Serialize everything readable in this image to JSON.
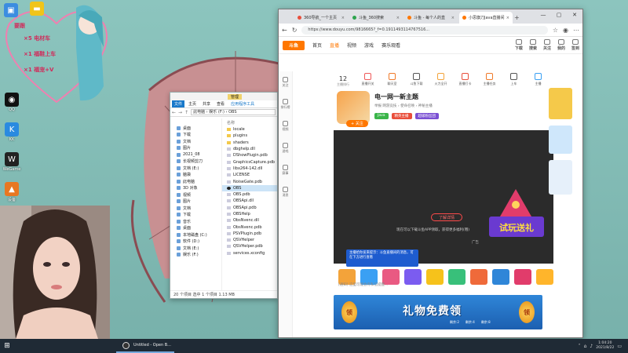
{
  "desktop": {
    "icons": [
      {
        "label": "QQ"
      },
      {
        "label": "KK"
      },
      {
        "label": "WeGame"
      },
      {
        "label": "设备"
      }
    ],
    "deco_lines": [
      "×5 电材车",
      "×1 福鞋上车",
      "×1 福宠+V"
    ],
    "deco_top": "要跟"
  },
  "explorer": {
    "title": "",
    "manage_label": "管理",
    "ribbon": [
      "文件",
      "主页",
      "共享",
      "查看",
      "应用程序工具"
    ],
    "path": "此电脑 › 娱乐 (F:) › OBS",
    "nav_items": [
      "桌面",
      "下载",
      "文档",
      "图片",
      "2021_08",
      "长视频剪刀",
      "文档 (E:)",
      "脑袋",
      "此电脑",
      "3D 对象",
      "视频",
      "图片",
      "文档",
      "下载",
      "音乐",
      "桌面",
      "本地磁盘 (C:)",
      "软件 (D:)",
      "文档 (E:)",
      "娱乐 (F:)"
    ],
    "column_header": "名称",
    "files": [
      {
        "name": "locale",
        "type": "folder"
      },
      {
        "name": "plugins",
        "type": "folder"
      },
      {
        "name": "shaders",
        "type": "folder"
      },
      {
        "name": "dbghelp.dll",
        "type": "file"
      },
      {
        "name": "DShowPlugin.pdb",
        "type": "file"
      },
      {
        "name": "GraphicsCapture.pdb",
        "type": "file"
      },
      {
        "name": "libx264-142.dll",
        "type": "file"
      },
      {
        "name": "LICENSE",
        "type": "file"
      },
      {
        "name": "NoiseGate.pdb",
        "type": "file"
      },
      {
        "name": "OBS",
        "type": "app"
      },
      {
        "name": "OBS.pdb",
        "type": "file"
      },
      {
        "name": "OBSApi.dll",
        "type": "file"
      },
      {
        "name": "OBSApi.pdb",
        "type": "file"
      },
      {
        "name": "OBSHelp",
        "type": "file"
      },
      {
        "name": "ObsNvenc.dll",
        "type": "file"
      },
      {
        "name": "ObsNvenc.pdb",
        "type": "file"
      },
      {
        "name": "PSVPlugin.pdb",
        "type": "file"
      },
      {
        "name": "QSVHelper",
        "type": "file"
      },
      {
        "name": "QSVHelper.pdb",
        "type": "file"
      },
      {
        "name": "services.xconfig",
        "type": "file"
      }
    ],
    "status": "20 个项目    选中 1 个项目  1.13 MB"
  },
  "browser": {
    "tabs": [
      {
        "label": "360导航_一个主页",
        "color": "#e94e3b"
      },
      {
        "label": "斗鱼_360搜索",
        "color": "#2da44e"
      },
      {
        "label": "斗鱼 - 每个人的直",
        "color": "#f70"
      },
      {
        "label": "小思旗刀Java直播间",
        "color": "#f70",
        "active": true
      }
    ],
    "url": "https://www.douyu.com/9816665?_f=0.1911493114767516...",
    "logo": "斗鱼",
    "nav": [
      "首页",
      "直播",
      "视频",
      "游戏",
      "赛乐观看"
    ],
    "nav_active": 1,
    "header_right": [
      "下载",
      "搜索",
      "关注",
      "我的",
      "签到"
    ],
    "sidebar": [
      "关注",
      "排行榜",
      "视频",
      "游戏",
      "赛事",
      "消息"
    ],
    "rank": {
      "num": "12",
      "label": "主播排行"
    },
    "toolbar": [
      "直播开关",
      "聊天室",
      "斗鱼下载",
      "火力全开",
      "直播打卡",
      "主播任务",
      "上车",
      "主播"
    ],
    "streamer": {
      "name": "电一网一新主题",
      "meta": "举报  网游竞技 › 使命召唤 › 神秘主播",
      "tags": [
        "Java",
        "精英主播",
        "超级粉丝团"
      ],
      "follow": "+ 关注"
    },
    "player": {
      "cta": "了解详情",
      "tip": "现在可以下载斗鱼APP领取，获得更多福利(哦)",
      "ad_tag": "广告"
    },
    "gift_tip": "主播给你发来提示：斗鱼直播间的消息，可在下方进行查看",
    "chat_placeholder": "[通知] 这里可能会有私信提醒...",
    "banner": {
      "big_text": "礼物免费领",
      "gold": "领",
      "counters": [
        "剩余:2",
        "剩余:4",
        "剩余:8"
      ]
    },
    "promo_text": "试玩送礼"
  },
  "taskbar": {
    "app_label": "Untitled - Open B...",
    "time": "1:04:20",
    "date": "2021/8/22"
  }
}
